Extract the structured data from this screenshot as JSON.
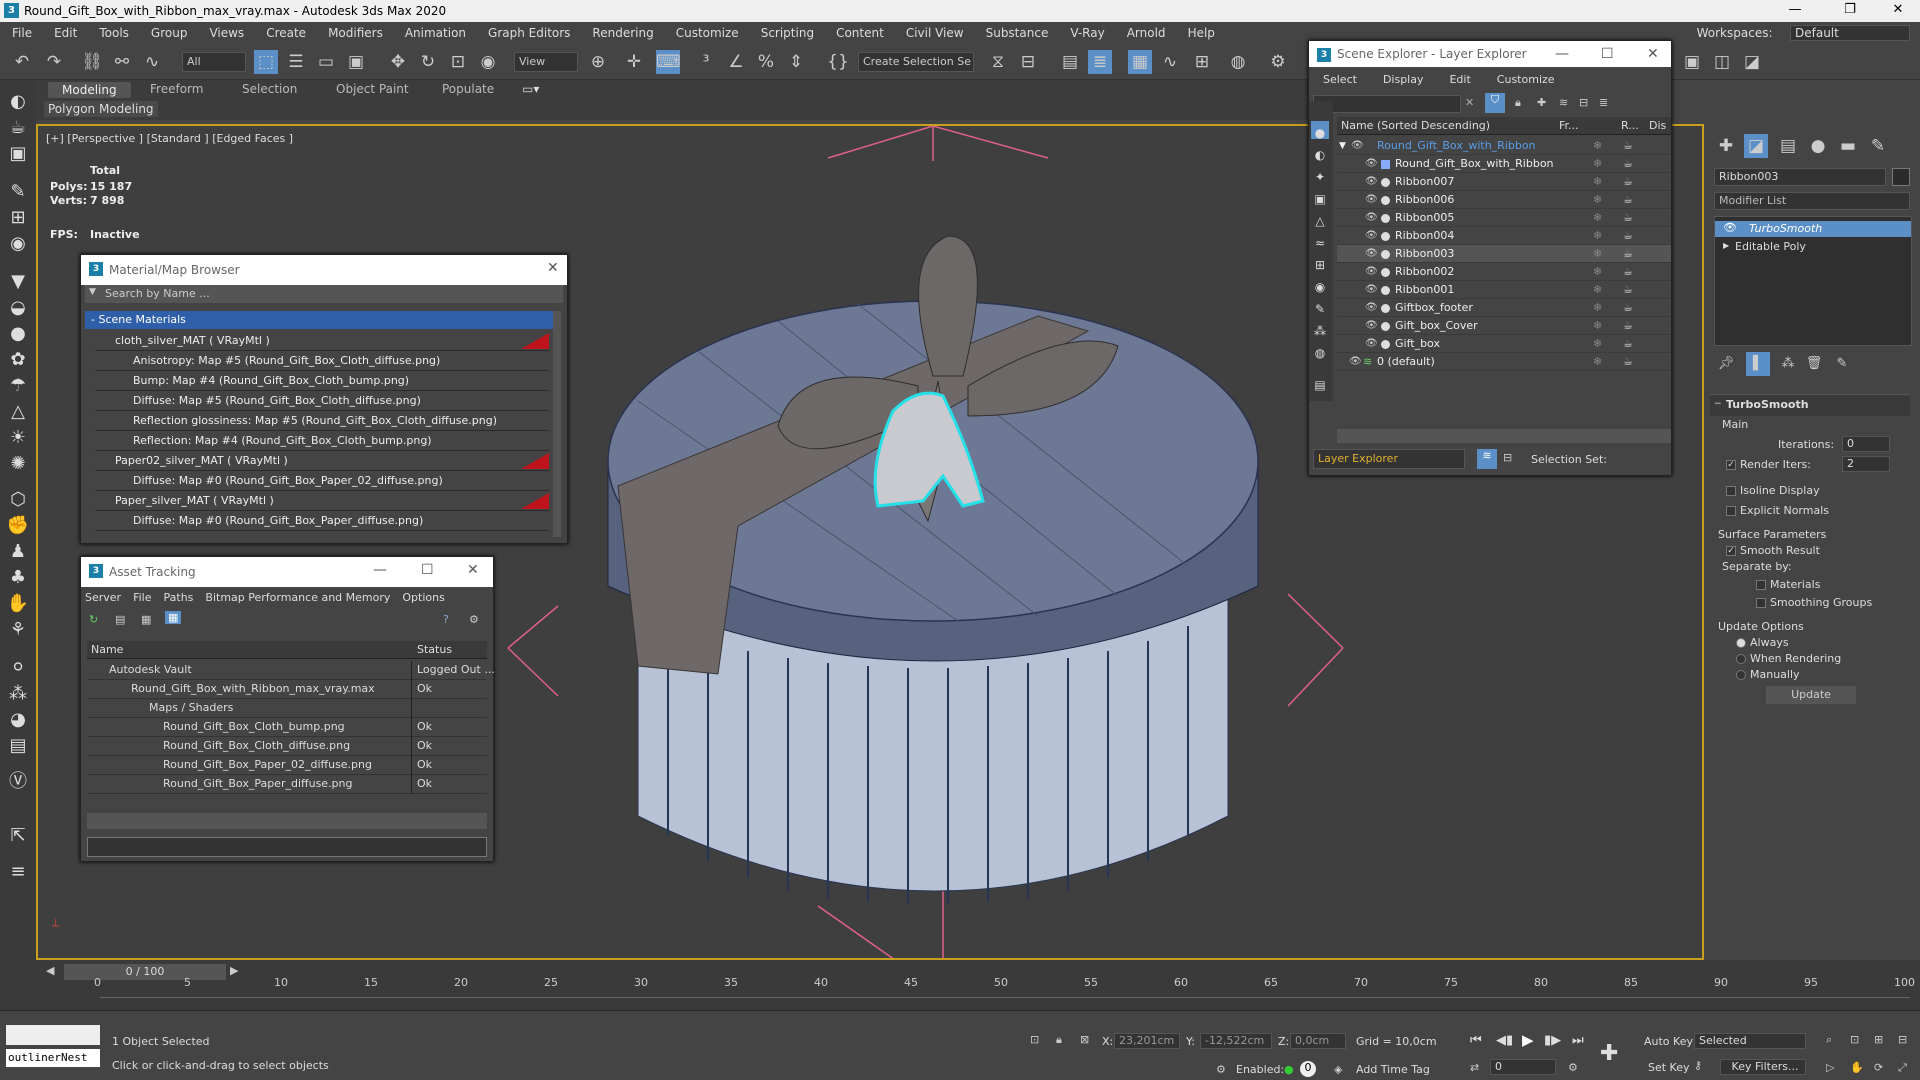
{
  "window": {
    "title": "Round_Gift_Box_with_Ribbon_max_vray.max - Autodesk 3ds Max 2020"
  },
  "menu": [
    "File",
    "Edit",
    "Tools",
    "Group",
    "Views",
    "Create",
    "Modifiers",
    "Animation",
    "Graph Editors",
    "Rendering",
    "Customize",
    "Scripting",
    "Content",
    "Civil View",
    "Substance",
    "V-Ray",
    "Arnold",
    "Help"
  ],
  "workspace": {
    "label": "Workspaces:",
    "value": "Default"
  },
  "toolbar": {
    "filter": "All",
    "view": "View",
    "selection_set": "Create Selection Se"
  },
  "ribbon": {
    "tabs": [
      "Modeling",
      "Freeform",
      "Selection",
      "Object Paint",
      "Populate"
    ],
    "sub": "Polygon Modeling"
  },
  "viewport": {
    "label": "[+] [Perspective ] [Standard ] [Edged Faces ]",
    "total_label": "Total",
    "polys_label": "Polys:",
    "polys_value": "15 187",
    "verts_label": "Verts:",
    "verts_value": "7 898",
    "fps_label": "FPS:",
    "fps_value": "Inactive"
  },
  "material_browser": {
    "title": "Material/Map Browser",
    "search_placeholder": "Search by Name ...",
    "section": "- Scene Materials",
    "rows": [
      "cloth_silver_MAT  ( VRayMtl )",
      "Anisotropy: Map #5 (Round_Gift_Box_Cloth_diffuse.png)",
      "Bump: Map #4 (Round_Gift_Box_Cloth_bump.png)",
      "Diffuse: Map #5 (Round_Gift_Box_Cloth_diffuse.png)",
      "Reflection glossiness: Map #5 (Round_Gift_Box_Cloth_diffuse.png)",
      "Reflection: Map #4 (Round_Gift_Box_Cloth_bump.png)",
      "Paper02_silver_MAT  ( VRayMtl )",
      "Diffuse: Map #0 (Round_Gift_Box_Paper_02_diffuse.png)",
      "Paper_silver_MAT  ( VRayMtl )",
      "Diffuse: Map #0 (Round_Gift_Box_Paper_diffuse.png)"
    ]
  },
  "asset_tracking": {
    "title": "Asset Tracking",
    "menu": [
      "Server",
      "File",
      "Paths",
      "Bitmap Performance and Memory",
      "Options"
    ],
    "col_name": "Name",
    "col_status": "Status",
    "rows": [
      {
        "name": "Autodesk Vault",
        "status": "Logged Out ..."
      },
      {
        "name": "Round_Gift_Box_with_Ribbon_max_vray.max",
        "status": "Ok"
      },
      {
        "name": "Maps / Shaders",
        "status": ""
      },
      {
        "name": "Round_Gift_Box_Cloth_bump.png",
        "status": "Ok"
      },
      {
        "name": "Round_Gift_Box_Cloth_diffuse.png",
        "status": "Ok"
      },
      {
        "name": "Round_Gift_Box_Paper_02_diffuse.png",
        "status": "Ok"
      },
      {
        "name": "Round_Gift_Box_Paper_diffuse.png",
        "status": "Ok"
      }
    ]
  },
  "scene_explorer": {
    "title": "Scene Explorer - Layer Explorer",
    "menu": [
      "Select",
      "Display",
      "Edit",
      "Customize"
    ],
    "col_name": "Name (Sorted Descending)",
    "col_fr": "Fr...",
    "col_r": "R...",
    "col_dis": "Dis",
    "rows": [
      "Round_Gift_Box_with_Ribbon",
      "Round_Gift_Box_with_Ribbon",
      "Ribbon007",
      "Ribbon006",
      "Ribbon005",
      "Ribbon004",
      "Ribbon003",
      "Ribbon002",
      "Ribbon001",
      "Giftbox_footer",
      "Gift_box_Cover",
      "Gift_box",
      "0 (default)"
    ],
    "footer_layer": "Layer Explorer",
    "footer_selset": "Selection Set:"
  },
  "command_panel": {
    "object_name": "Ribbon003",
    "modifier_list": "Modifier List",
    "stack": [
      "TurboSmooth",
      "Editable Poly"
    ],
    "rollout": "TurboSmooth",
    "main": "Main",
    "iterations_label": "Iterations:",
    "iterations": "0",
    "render_iters_label": "Render Iters:",
    "render_iters": "2",
    "isoline": "Isoline Display",
    "explicit": "Explicit Normals",
    "surface": "Surface Parameters",
    "smooth_result": "Smooth Result",
    "separate_by": "Separate by:",
    "materials": "Materials",
    "smoothing_groups": "Smoothing Groups",
    "update_options": "Update Options",
    "always": "Always",
    "when_rendering": "When Rendering",
    "manually": "Manually",
    "update": "Update"
  },
  "timeline": {
    "frame": "0 / 100",
    "ticks": [
      "0",
      "5",
      "10",
      "15",
      "20",
      "25",
      "30",
      "35",
      "40",
      "45",
      "50",
      "55",
      "60",
      "65",
      "70",
      "75",
      "80",
      "85",
      "90",
      "95",
      "100"
    ]
  },
  "status": {
    "selected": "1 Object Selected",
    "hint": "Click or click-and-drag to select objects",
    "maxscript": "outlinerNest",
    "x_label": "X:",
    "x": "23,201cm",
    "y_label": "Y:",
    "y": "-12,522cm",
    "z_label": "Z:",
    "z": "0,0cm",
    "grid": "Grid = 10,0cm",
    "enabled": "Enabled:",
    "add_time_tag": "Add Time Tag",
    "auto_key": "Auto Key",
    "set_key": "Set Key",
    "key_mode": "Selected",
    "key_filters": "Key Filters...",
    "frame_field": "0"
  },
  "colors": {
    "accent": "#c9a01c",
    "selection": "#25e0e8",
    "ribbon_active": "#555555"
  }
}
